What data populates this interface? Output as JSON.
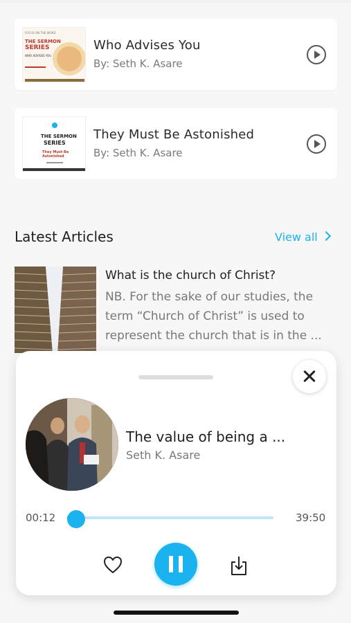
{
  "sermons": [
    {
      "title": "Who Advises You",
      "author": "By: Seth K. Asare",
      "thumb_label": "THE SERMON SERIES",
      "thumb_sub": "WHO ADVISES YOU",
      "thumb_caption": "FOCUS ON THE WORD"
    },
    {
      "title": "They Must Be Astonished",
      "author": "By: Seth K. Asare",
      "thumb_label": "THE SERMON SERIES",
      "thumb_sub": "They Must Be Astonished"
    }
  ],
  "section": {
    "title": "Latest Articles",
    "view_all": "View all"
  },
  "article": {
    "title": "What is the church of Christ?",
    "excerpt": "NB. For the sake of our studies, the term “Church of Christ” is used to represent the church that is in the ..."
  },
  "player": {
    "title": "The value of being a ...",
    "artist": "Seth K. Asare",
    "current_time": "00:12",
    "total_time": "39:50",
    "progress": 0.005
  },
  "colors": {
    "accent": "#1ab3ef",
    "background": "#f7f7f7"
  },
  "icons": {
    "play": "play-circle-icon",
    "close": "close-icon",
    "heart": "heart-icon",
    "pause": "pause-icon",
    "download": "download-icon",
    "chevron": "chevron-right-icon"
  }
}
